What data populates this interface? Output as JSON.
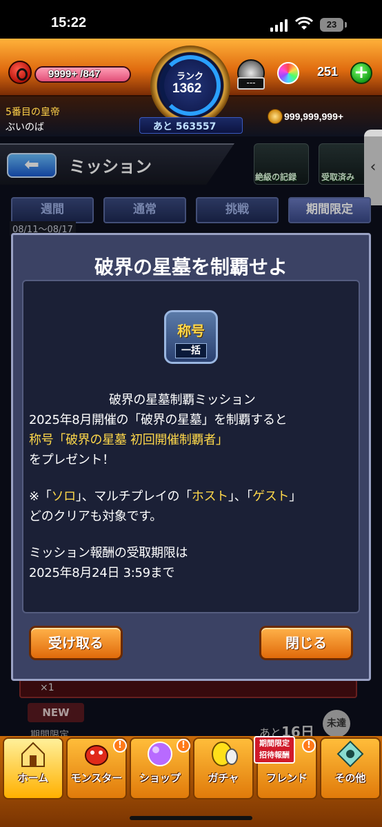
{
  "status_bar": {
    "time": "15:22",
    "battery": "23"
  },
  "hud": {
    "stamina": "9999+ /847",
    "rank_label": "ランク",
    "rank_value": "1362",
    "rank_remaining": "あと 563557",
    "gauge_value": "---",
    "orb_count": "251",
    "plus_icon": "plus-icon",
    "player_title": "5番目の皇帝",
    "player_name": "ぶいのば",
    "coins": "999,999,999+"
  },
  "header": {
    "back_icon": "back-arrow-icon",
    "title": "ミッション",
    "shortcuts": [
      "絶級の記録",
      "受取済み"
    ]
  },
  "tabs": [
    {
      "label": "週間",
      "active": false
    },
    {
      "label": "通常",
      "active": false
    },
    {
      "label": "挑戦",
      "active": false
    },
    {
      "label": "期間限定",
      "active": true
    }
  ],
  "date_range": "08/11〜08/17",
  "background_list": {
    "count": "×1",
    "new_label": "NEW",
    "limited_label": "期間限定",
    "remaining_prefix": "あと",
    "remaining_days": "16日",
    "status_badge": "未達成"
  },
  "modal": {
    "title": "破界の星墓を制覇せよ",
    "reward_badge": {
      "top": "称号",
      "bottom": "一括"
    },
    "lines": {
      "l1": "破界の星墓制覇ミッション",
      "l2": "2025年8月開催の「破界の星墓」を制覇すると",
      "l3": "称号「破界の星墓 初回開催制覇者」",
      "l4": "をプレゼント！",
      "l5a": "※「",
      "l5b": "ソロ",
      "l5c": "」、マルチプレイの「",
      "l5d": "ホスト",
      "l5e": "」、「",
      "l5f": "ゲスト",
      "l5g": "」",
      "l6": "どのクリアも対象です。",
      "l7": "ミッション報酬の受取期限は",
      "l8": "2025年8月24日 3:59まで"
    },
    "receive_button": "受け取る",
    "close_button": "閉じる"
  },
  "bottom_nav": {
    "items": [
      "ホーム",
      "モンスター",
      "ショップ",
      "ガチャ",
      "フレンド",
      "その他"
    ],
    "friend_tag": "期間限定 招待報酬",
    "alert_mark": "!"
  },
  "colors": {
    "accent_orange": "#e06a0a",
    "highlight_yellow": "#ffd84a",
    "modal_bg": "#3b4264"
  }
}
